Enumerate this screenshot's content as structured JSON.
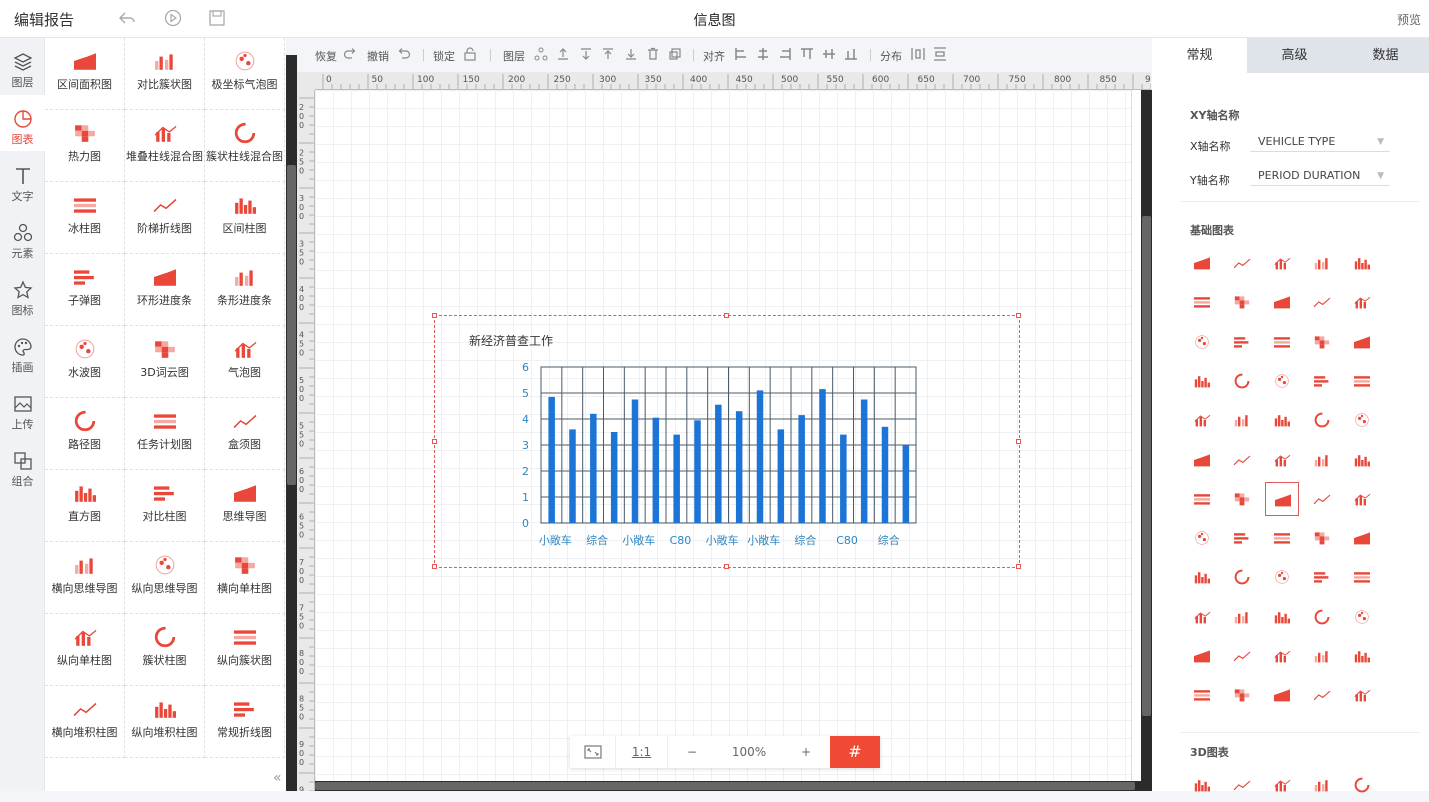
{
  "header": {
    "title": "编辑报告",
    "center_title": "信息图",
    "preview": "预览"
  },
  "left_nav": [
    {
      "label": "图层",
      "icon": "layers-icon"
    },
    {
      "label": "图表",
      "icon": "chart-pie-icon"
    },
    {
      "label": "文字",
      "icon": "text-icon"
    },
    {
      "label": "元素",
      "icon": "shapes-icon"
    },
    {
      "label": "图标",
      "icon": "star-icon"
    },
    {
      "label": "插画",
      "icon": "palette-icon"
    },
    {
      "label": "上传",
      "icon": "image-upload-icon"
    },
    {
      "label": "组合",
      "icon": "group-icon"
    }
  ],
  "gallery": [
    "区间面积图",
    "对比簇状图",
    "极坐标气泡图",
    "热力图",
    "堆叠柱线混合图",
    "簇状柱线混合图",
    "冰柱图",
    "阶梯折线图",
    "区间柱图",
    "子弹图",
    "环形进度条",
    "条形进度条",
    "水波图",
    "3D词云图",
    "气泡图",
    "路径图",
    "任务计划图",
    "盒须图",
    "直方图",
    "对比柱图",
    "思维导图",
    "横向思维导图",
    "纵向思维导图",
    "横向单柱图",
    "纵向单柱图",
    "簇状柱图",
    "纵向簇状图",
    "横向堆积柱图",
    "纵向堆积柱图",
    "常规折线图"
  ],
  "toolbar": {
    "restore": "恢复",
    "undo": "撤销",
    "lock": "锁定",
    "layer": "图层",
    "align": "对齐",
    "distribute": "分布"
  },
  "ruler_labels": [
    "0",
    "50",
    "100",
    "150",
    "200",
    "250",
    "300",
    "350",
    "400",
    "450",
    "500",
    "550",
    "600",
    "650",
    "700",
    "750",
    "800",
    "850",
    "900"
  ],
  "ruler_v_labels": [
    "200",
    "250",
    "300",
    "350",
    "400",
    "450",
    "500",
    "550",
    "600",
    "650",
    "700",
    "750",
    "800",
    "850",
    "900",
    "95"
  ],
  "zoom": {
    "fit": "fit",
    "one_to_one": "1:1",
    "minus": "−",
    "value": "100%",
    "plus": "+",
    "grid": "#"
  },
  "right_panel": {
    "tabs": [
      "常规",
      "高级",
      "数据"
    ],
    "xy_section": "XY轴名称",
    "x_label": "X轴名称",
    "x_value": "VEHICLE TYPE",
    "y_label": "Y轴名称",
    "y_value": "PERIOD DURATION",
    "basic_section": "基础图表",
    "section_3d": "3D图表"
  },
  "chart_data": {
    "type": "bar",
    "title": "新经济普查工作",
    "categories": [
      "小敞车",
      "",
      "综合",
      "",
      "小敞车",
      "",
      "C80",
      "",
      "小敞车",
      "",
      "小敞车",
      "",
      "综合",
      "",
      "C80",
      "",
      "综合",
      ""
    ],
    "values": [
      4.85,
      3.6,
      4.2,
      3.5,
      4.75,
      4.05,
      3.4,
      3.95,
      4.55,
      4.3,
      5.1,
      3.6,
      4.15,
      5.15,
      3.4,
      4.75,
      3.7,
      3.0
    ],
    "ylim": [
      0,
      6
    ],
    "yticks": [
      "0",
      "1",
      "2",
      "3",
      "4",
      "5",
      "6"
    ],
    "bar_color": "#1c74d6",
    "grid": true
  },
  "colors": {
    "accent": "#f04a35",
    "icon_red": "#e8473a"
  }
}
